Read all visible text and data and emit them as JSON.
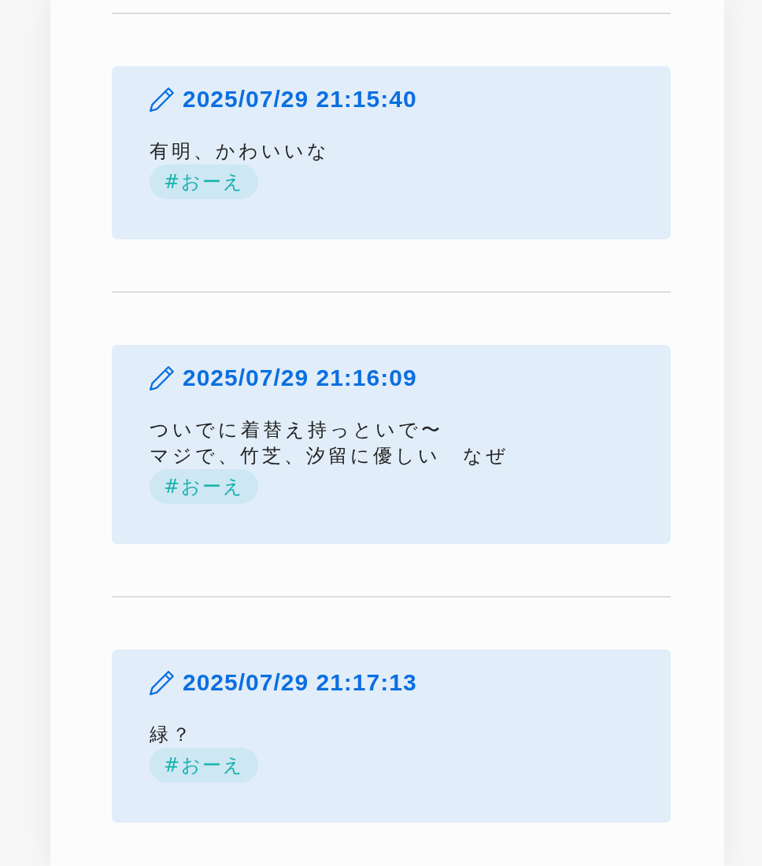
{
  "posts": [
    {
      "timestamp": "2025/07/29 21:15:40",
      "lines": [
        "有明、かわいいな"
      ],
      "tags": [
        "#おーえ"
      ]
    },
    {
      "timestamp": "2025/07/29 21:16:09",
      "lines": [
        "ついでに着替え持っといで〜",
        "マジで、竹芝、汐留に優しい　なぜ"
      ],
      "tags": [
        "#おーえ"
      ]
    },
    {
      "timestamp": "2025/07/29 21:17:13",
      "lines": [
        "緑？"
      ],
      "tags": [
        "#おーえ"
      ]
    }
  ]
}
